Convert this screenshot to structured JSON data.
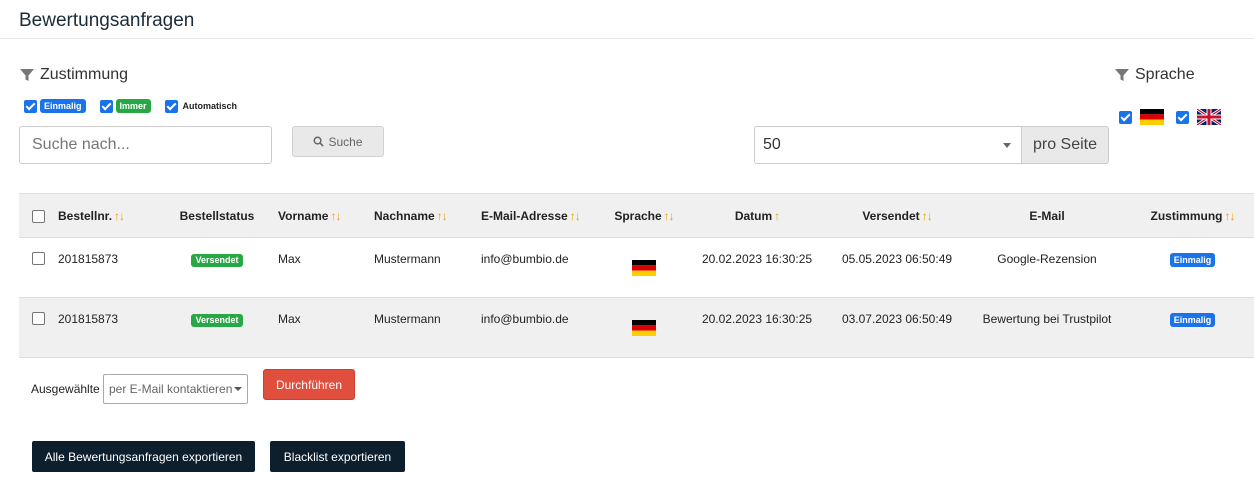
{
  "page": {
    "title": "Bewertungsanfragen"
  },
  "filters": {
    "consent": {
      "label": "Zustimmung",
      "options": [
        {
          "label": "Einmalig",
          "checked": true,
          "style": "badge-blue"
        },
        {
          "label": "Immer",
          "checked": true,
          "style": "badge-green"
        },
        {
          "label": "Automatisch",
          "checked": true,
          "style": "plain"
        }
      ]
    },
    "language": {
      "label": "Sprache",
      "options": [
        {
          "flag": "de-flag",
          "checked": true
        },
        {
          "flag": "gb-flag",
          "checked": true
        }
      ]
    }
  },
  "search": {
    "placeholder": "Suche nach...",
    "button_label": "Suche",
    "icon": "search-icon"
  },
  "pagination": {
    "per_page_value": "50",
    "per_page_suffix": "pro Seite"
  },
  "table": {
    "columns": [
      "Bestellnr.",
      "Bestellstatus",
      "Vorname",
      "Nachname",
      "E-Mail-Adresse",
      "Sprache",
      "Datum",
      "Versendet",
      "E-Mail",
      "Zustimmung"
    ],
    "sort_arrows": {
      "up": "↑",
      "down": "↓"
    },
    "rows": [
      {
        "order": "201815873",
        "status": "Versendet",
        "first_name": "Max",
        "last_name": "Mustermann",
        "email": "info@bumbio.de",
        "language": "de-flag",
        "date": "20.02.2023 16:30:25",
        "sent": "05.05.2023 06:50:49",
        "mail": "Google-Rezension",
        "consent": "Einmalig"
      },
      {
        "order": "201815873",
        "status": "Versendet",
        "first_name": "Max",
        "last_name": "Mustermann",
        "email": "info@bumbio.de",
        "language": "de-flag",
        "date": "20.02.2023 16:30:25",
        "sent": "03.07.2023 06:50:49",
        "mail": "Bewertung bei Trustpilot",
        "consent": "Einmalig"
      }
    ]
  },
  "bulk": {
    "label": "Ausgewählte",
    "action_value": "per E-Mail kontaktieren",
    "run_label": "Durchführen"
  },
  "export": {
    "all_label": "Alle Bewertungsanfragen exportieren",
    "blacklist_label": "Blacklist exportieren"
  },
  "colors": {
    "accent_blue": "#1a73e8",
    "success_green": "#28a745",
    "danger_red": "#e04f3e",
    "dark_button": "#0d1e2c",
    "sort_arrow": "#f0a000"
  }
}
